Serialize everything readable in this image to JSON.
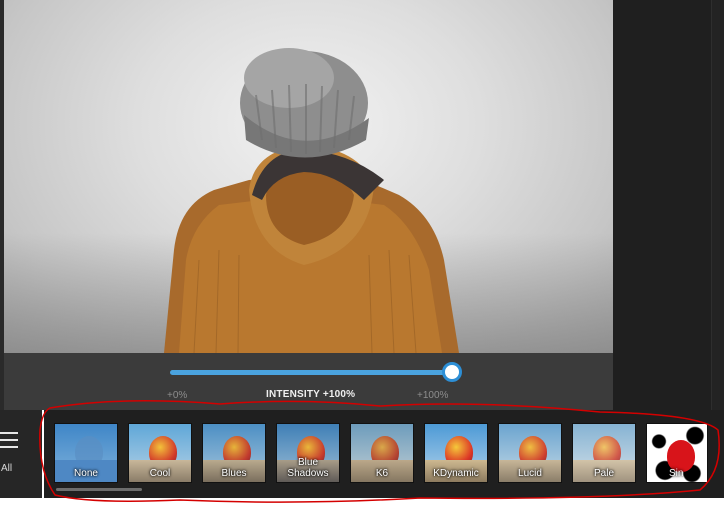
{
  "editor": {
    "photo_alt": "Person in knit beanie and brown corduroy hooded jacket facing a misty landscape"
  },
  "intensity": {
    "title": "INTENSITY +100%",
    "min_label": "+0%",
    "max_label": "+100%",
    "value_percent": 100
  },
  "filters": {
    "all_label": "All",
    "items": [
      {
        "label": "None"
      },
      {
        "label": "Cool"
      },
      {
        "label": "Blues"
      },
      {
        "label": "Blue\nShadows"
      },
      {
        "label": "K6"
      },
      {
        "label": "KDynamic"
      },
      {
        "label": "Lucid"
      },
      {
        "label": "Pale"
      },
      {
        "label": "Sin"
      }
    ]
  },
  "colors": {
    "accent": "#4aa3df",
    "annotation": "#d40000"
  }
}
